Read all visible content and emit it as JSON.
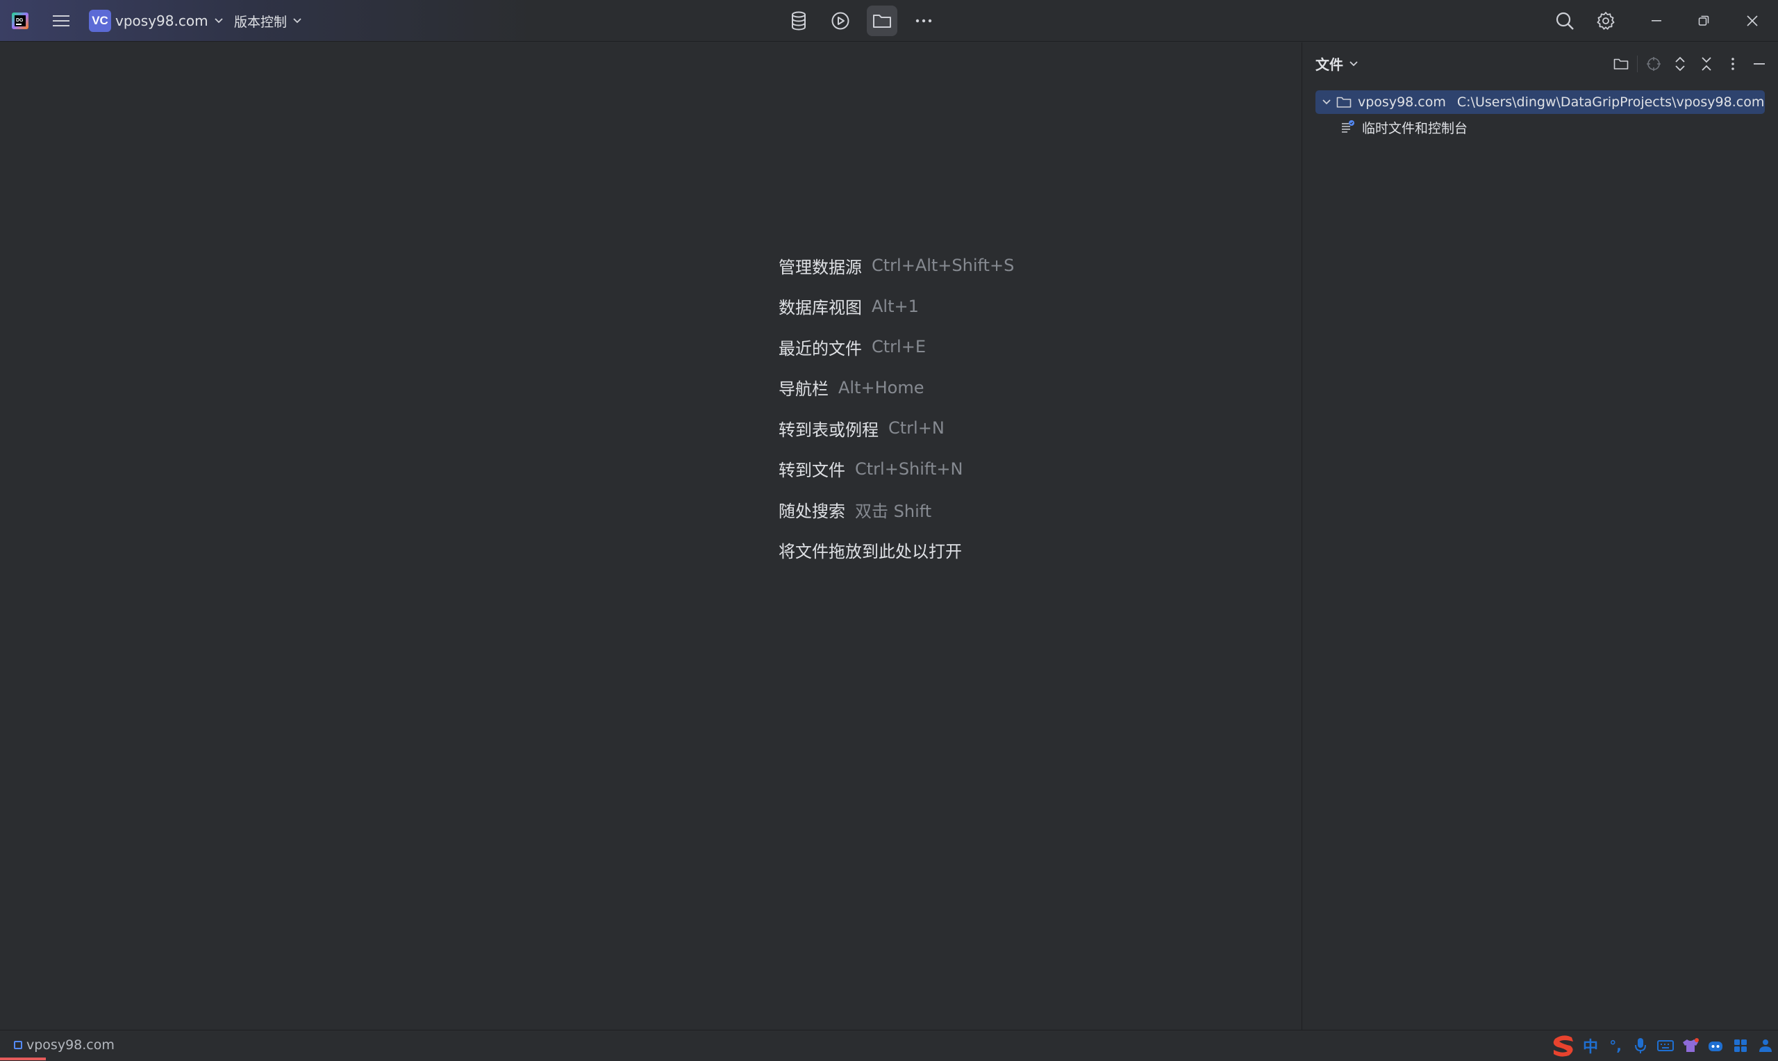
{
  "titlebar": {
    "project": {
      "badge": "VC",
      "name": "vposy98.com"
    },
    "vcs_label": "版本控制",
    "icons": {
      "app": "datagrip-logo-icon",
      "menu": "hamburger-menu-icon",
      "database": "database-icon",
      "run": "run-icon",
      "project": "folder-icon",
      "more": "more-horizontal-icon",
      "search": "search-icon",
      "settings": "gear-icon",
      "minimize": "minimize-icon",
      "restore": "restore-icon",
      "close": "close-icon"
    }
  },
  "welcome": {
    "hints": [
      {
        "action": "管理数据源",
        "shortcut": "Ctrl+Alt+Shift+S"
      },
      {
        "action": "数据库视图",
        "shortcut": "Alt+1"
      },
      {
        "action": "最近的文件",
        "shortcut": "Ctrl+E"
      },
      {
        "action": "导航栏",
        "shortcut": "Alt+Home"
      },
      {
        "action": "转到表或例程",
        "shortcut": "Ctrl+N"
      },
      {
        "action": "转到文件",
        "shortcut": "Ctrl+Shift+N"
      },
      {
        "action": "随处搜索",
        "shortcut": "双击 Shift"
      },
      {
        "action": "将文件拖放到此处以打开",
        "shortcut": ""
      }
    ]
  },
  "tool_window": {
    "title": "文件",
    "tree": {
      "root": {
        "name": "vposy98.com",
        "path": "C:\\Users\\dingw\\DataGripProjects\\vposy98.com"
      },
      "child": {
        "name": "临时文件和控制台"
      }
    }
  },
  "statusbar": {
    "breadcrumb": "vposy98.com",
    "ime": {
      "mode": "中",
      "punct": "°,"
    }
  },
  "colors": {
    "background": "#2b2d30",
    "selection": "#2e436e",
    "project_badge": "#5c6bd6",
    "accent_blue": "#548af7",
    "ime_red": "#e8432e"
  }
}
